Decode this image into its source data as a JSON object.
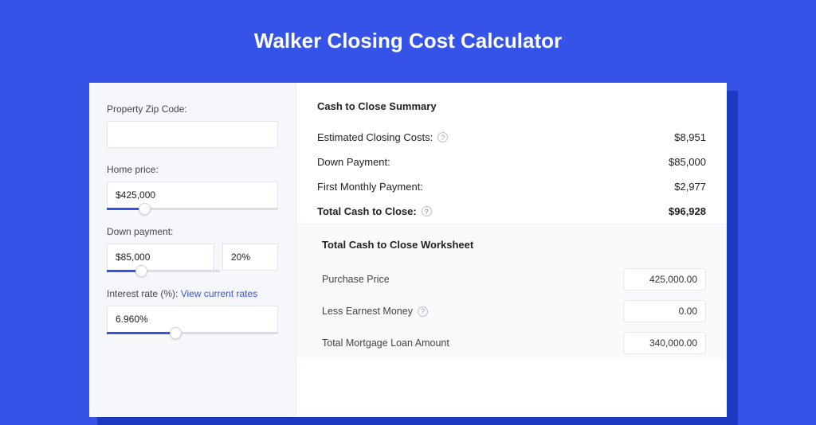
{
  "title": "Walker Closing Cost Calculator",
  "form": {
    "zip_label": "Property Zip Code:",
    "zip_value": "",
    "home_price_label": "Home price:",
    "home_price_value": "$425,000",
    "home_price_fill_pct": 22,
    "down_payment_label": "Down payment:",
    "down_payment_value": "$85,000",
    "down_payment_pct_value": "20%",
    "down_payment_fill_pct": 30,
    "interest_label_prefix": "Interest rate (%): ",
    "interest_link": "View current rates",
    "interest_value": "6.960%",
    "interest_fill_pct": 40
  },
  "summary": {
    "heading": "Cash to Close Summary",
    "rows": [
      {
        "label": "Estimated Closing Costs:",
        "help": true,
        "value": "$8,951",
        "strong": false
      },
      {
        "label": "Down Payment:",
        "help": false,
        "value": "$85,000",
        "strong": false
      },
      {
        "label": "First Monthly Payment:",
        "help": false,
        "value": "$2,977",
        "strong": false
      },
      {
        "label": "Total Cash to Close:",
        "help": true,
        "value": "$96,928",
        "strong": true
      }
    ]
  },
  "worksheet": {
    "heading": "Total Cash to Close Worksheet",
    "rows": [
      {
        "label": "Purchase Price",
        "help": false,
        "value": "425,000.00"
      },
      {
        "label": "Less Earnest Money",
        "help": true,
        "value": "0.00"
      },
      {
        "label": "Total Mortgage Loan Amount",
        "help": false,
        "value": "340,000.00"
      }
    ]
  }
}
